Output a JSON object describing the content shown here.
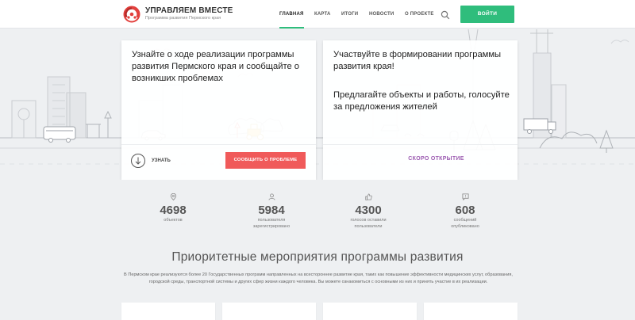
{
  "header": {
    "logo_title": "УПРАВЛЯЕМ ВМЕСТЕ",
    "logo_subtitle": "Программа развития Пермского края",
    "nav": [
      {
        "label": "ГЛАВНАЯ",
        "active": true
      },
      {
        "label": "КАРТА",
        "active": false
      },
      {
        "label": "ИТОГИ",
        "active": false
      },
      {
        "label": "НОВОСТИ",
        "active": false
      },
      {
        "label": "О ПРОЕКТЕ",
        "active": false
      }
    ],
    "search_icon": "search-icon",
    "login_label": "ВОЙТИ",
    "accent_color": "#2fbd7c"
  },
  "hero": {
    "left_card": {
      "title": "Узнайте о ходе реализации программы развития Пермского края и сообщайте о возникших проблемах",
      "learn_label": "УЗНАТЬ",
      "report_label": "СООБЩИТЬ О ПРОБЛЕМЕ",
      "report_color": "#f05a5a"
    },
    "right_card": {
      "title": "Участвуйте в формировании программы развития края!",
      "subtitle": "Предлагайте объекты и работы, голосуйте за предложения жителей",
      "soon_label": "СКОРО ОТКРЫТИЕ",
      "soon_color": "#9c5bb1"
    }
  },
  "stats": [
    {
      "icon": "map-pin-icon",
      "value": "4698",
      "label": "объектов"
    },
    {
      "icon": "user-icon",
      "value": "5984",
      "label": "пользователя зарегистрировано"
    },
    {
      "icon": "thumbs-up-icon",
      "value": "4300",
      "label": "голосов оставили пользователи"
    },
    {
      "icon": "message-icon",
      "value": "608",
      "label": "сообщений опубликовано"
    }
  ],
  "priorities": {
    "title": "Приоритетные мероприятия программы развития",
    "text": "В Пермском крае реализуются более 20 Государственных программ направленных на всестороннее развитие края, таких как повышение эффективности медицинских услуг, образования, городской среды, транспортной системы и других сфер жизни каждого человека. Вы можете ознакомиться с основными из них и принять участие в их реализации."
  }
}
